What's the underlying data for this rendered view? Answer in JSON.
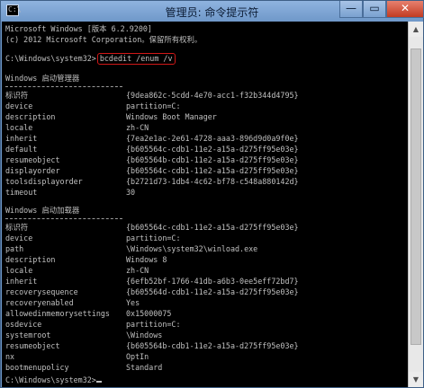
{
  "window": {
    "title": "管理员: 命令提示符",
    "app_icon": "C:\\",
    "minimize_label": "—",
    "maximize_label": "▭",
    "close_label": "✕"
  },
  "console": {
    "header": [
      "Microsoft Windows [版本 6.2.9200]",
      "(c) 2012 Microsoft Corporation。保留所有权利。"
    ],
    "prompt": "C:\\Windows\\system32>",
    "command": "bcdedit /enum /v",
    "section1": {
      "title": "Windows 启动管理器",
      "rows": [
        {
          "k": "标识符",
          "v": "{9dea862c-5cdd-4e70-acc1-f32b344d4795}"
        },
        {
          "k": "device",
          "v": "partition=C:"
        },
        {
          "k": "description",
          "v": "Windows Boot Manager"
        },
        {
          "k": "locale",
          "v": "zh-CN"
        },
        {
          "k": "inherit",
          "v": "{7ea2e1ac-2e61-4728-aaa3-896d9d0a9f0e}"
        },
        {
          "k": "default",
          "v": "{b605564c-cdb1-11e2-a15a-d275ff95e03e}"
        },
        {
          "k": "resumeobject",
          "v": "{b605564b-cdb1-11e2-a15a-d275ff95e03e}"
        },
        {
          "k": "displayorder",
          "v": "{b605564c-cdb1-11e2-a15a-d275ff95e03e}"
        },
        {
          "k": "toolsdisplayorder",
          "v": "{b2721d73-1db4-4c62-bf78-c548a880142d}"
        },
        {
          "k": "timeout",
          "v": "30"
        }
      ]
    },
    "section2": {
      "title": "Windows 启动加载器",
      "rows": [
        {
          "k": "标识符",
          "v": "{b605564c-cdb1-11e2-a15a-d275ff95e03e}"
        },
        {
          "k": "device",
          "v": "partition=C:"
        },
        {
          "k": "path",
          "v": "\\Windows\\system32\\winload.exe"
        },
        {
          "k": "description",
          "v": "Windows 8"
        },
        {
          "k": "locale",
          "v": "zh-CN"
        },
        {
          "k": "inherit",
          "v": "{6efb52bf-1766-41db-a6b3-0ee5eff72bd7}"
        },
        {
          "k": "recoverysequence",
          "v": "{b605564d-cdb1-11e2-a15a-d275ff95e03e}"
        },
        {
          "k": "recoveryenabled",
          "v": "Yes"
        },
        {
          "k": "allowedinmemorysettings",
          "v": "0x15000075"
        },
        {
          "k": "osdevice",
          "v": "partition=C:"
        },
        {
          "k": "systemroot",
          "v": "\\Windows"
        },
        {
          "k": "resumeobject",
          "v": "{b605564b-cdb1-11e2-a15a-d275ff95e03e}"
        },
        {
          "k": "nx",
          "v": "OptIn"
        },
        {
          "k": "bootmenupolicy",
          "v": "Standard"
        }
      ]
    },
    "final_prompt": "C:\\Windows\\system32>"
  }
}
